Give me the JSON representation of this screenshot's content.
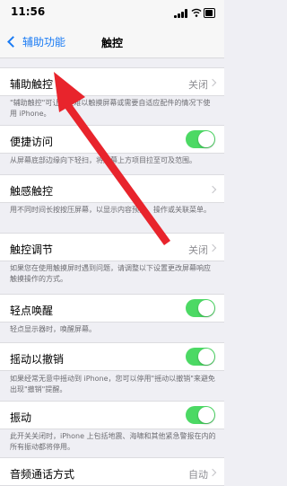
{
  "status_bar": {
    "time": "11:56"
  },
  "nav": {
    "back_label": "辅助功能",
    "title": "触控"
  },
  "rows": {
    "assistive_touch": {
      "label": "辅助触控",
      "value": "关闭"
    },
    "reachability": {
      "label": "便捷访问",
      "toggle_on": true
    },
    "haptic_touch": {
      "label": "触感触控"
    },
    "touch_accommodations": {
      "label": "触控调节",
      "value": "关闭"
    },
    "tap_to_wake": {
      "label": "轻点唤醒",
      "toggle_on": true
    },
    "shake_to_undo": {
      "label": "摇动以撤销",
      "toggle_on": true
    },
    "vibration": {
      "label": "振动",
      "toggle_on": true
    },
    "call_audio_routing": {
      "label": "音频通话方式",
      "value": "自动"
    }
  },
  "footnotes": {
    "assistive_touch": "\"辅助触控\"可让您在难以触摸屏幕或需要自适应配件的情况下使用 iPhone。",
    "reachability": "从屏幕底部边缘向下轻扫，将屏幕上方项目拉至可及范围。",
    "haptic_touch": "用不同时间长按按压屏幕，以显示内容预览、操作或关联菜单。",
    "touch_accommodations": "如果您在使用触摸屏时遇到问题，请调整以下设置更改屏幕响应触摸操作的方式。",
    "tap_to_wake": "轻点显示器时，唤醒屏幕。",
    "shake_to_undo": "如果经常无意中摇动到 iPhone，您可以停用\"摇动以撤销\"来避免出现\"撤销\"提醒。",
    "vibration": "此开关关闭时，iPhone 上包括地震、海啸和其他紧急警报在内的所有振动都将停用。"
  },
  "colors": {
    "accent": "#1a7bf4",
    "toggle_on": "#4cd964",
    "annotation_arrow": "#e8242c"
  },
  "icons": {
    "back": "chevron-left-icon",
    "disclosure": "chevron-right-icon",
    "signal": "signal-icon",
    "wifi": "wifi-icon",
    "battery": "battery-icon"
  }
}
